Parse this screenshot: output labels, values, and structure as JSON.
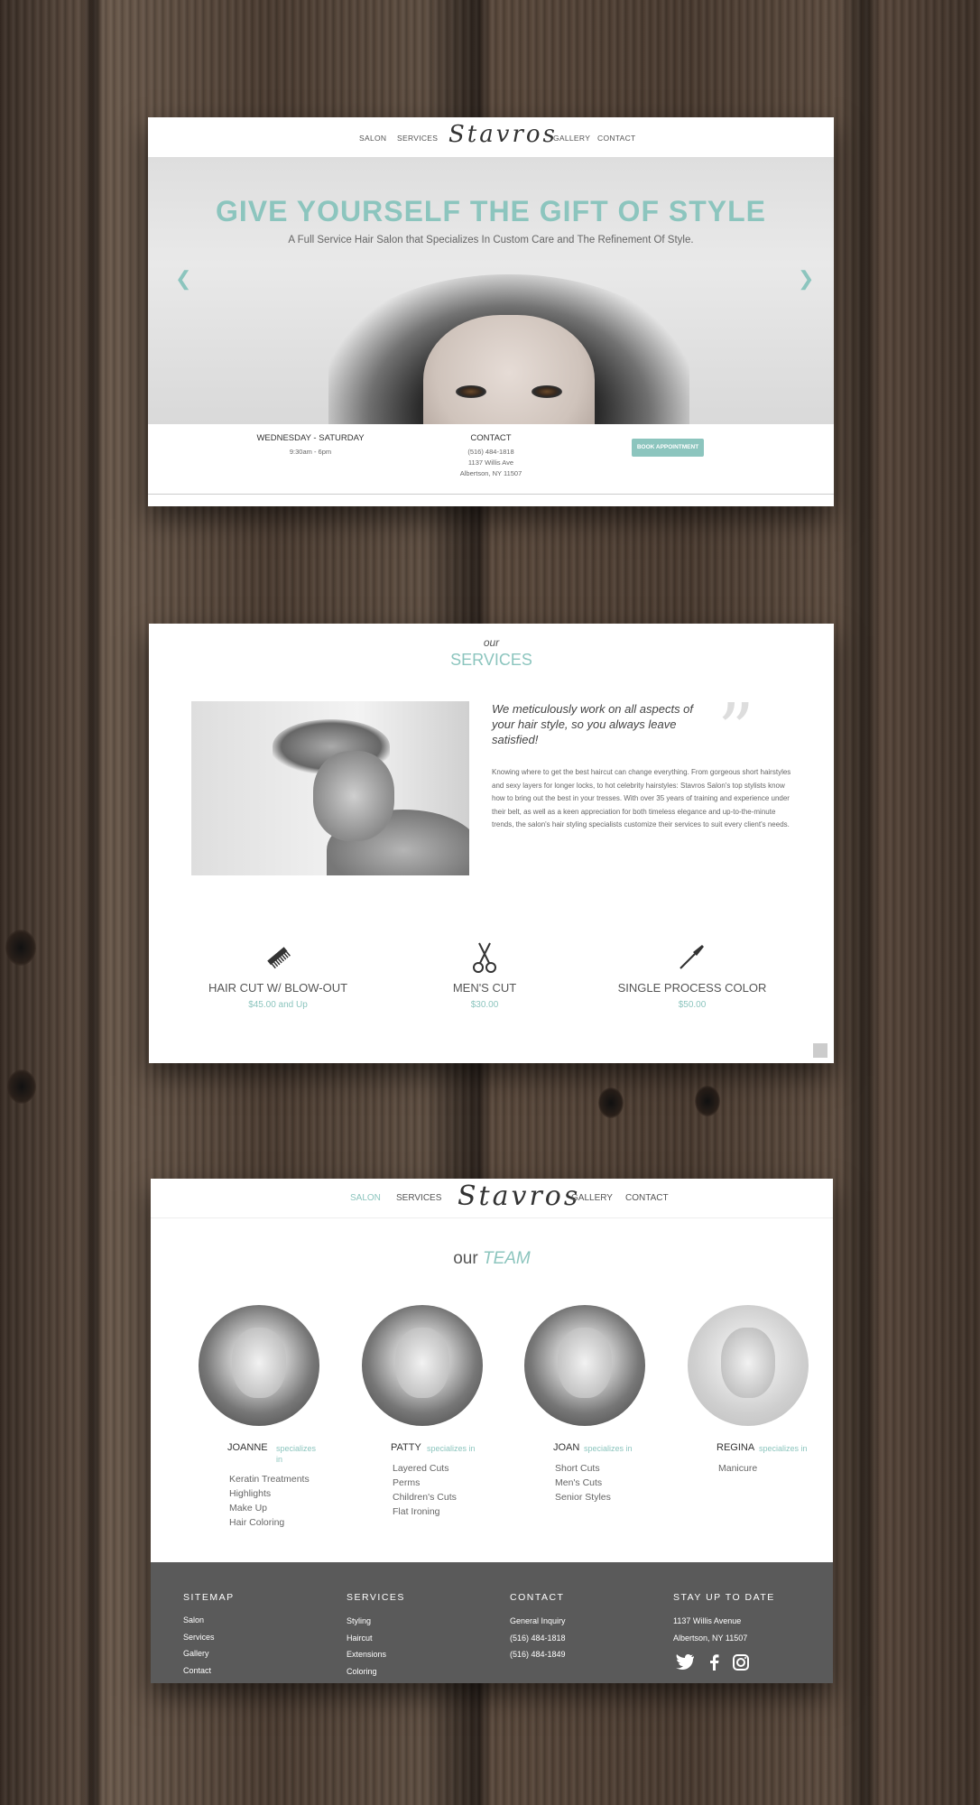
{
  "colors": {
    "accent": "#8cc5be",
    "footer_bg": "#5a5a5a"
  },
  "panel1": {
    "nav": {
      "salon": "SALON",
      "services": "SERVICES",
      "logo": "Stavros",
      "gallery": "GALLERY",
      "contact": "CONTACT"
    },
    "hero": {
      "title": "GIVE YOURSELF THE GIFT OF STYLE",
      "subtitle": "A Full Service Hair Salon that Specializes In Custom Care and The Refinement Of Style.",
      "prev_icon": "chevron-left-icon",
      "next_icon": "chevron-right-icon"
    },
    "hours": {
      "heading": "WEDNESDAY - SATURDAY",
      "time": "9:30am - 6pm"
    },
    "contact": {
      "heading": "CONTACT",
      "phone": "(516) 484-1818",
      "street": "1137 Willis Ave",
      "city": "Albertson, NY 11507"
    },
    "book_button": "BOOK APPOINTMENT"
  },
  "panel2": {
    "our": "our",
    "title": "SERVICES",
    "quote": "We meticulously work on all aspects of your hair style, so you always leave satisfied!",
    "paragraph": "Knowing where to get the best haircut can change everything. From gorgeous short hairstyles and sexy layers for longer locks, to hot celebrity hairstyles: Stavros Salon's top stylists know how to bring out the best in your tresses. With over 35 years of training and experience under their belt, as well as a keen appreciation for both timeless elegance and up-to-the-minute trends, the salon's hair styling specialists customize their services to suit every client's needs.",
    "services": [
      {
        "name": "HAIR CUT W/ BLOW-OUT",
        "price": "$45.00 and Up",
        "icon": "comb-icon"
      },
      {
        "name": "MEN'S CUT",
        "price": "$30.00",
        "icon": "scissors-icon"
      },
      {
        "name": "SINGLE PROCESS COLOR",
        "price": "$50.00",
        "icon": "brush-icon"
      }
    ]
  },
  "panel3": {
    "nav": {
      "salon": "SALON",
      "services": "SERVICES",
      "logo": "Stavros",
      "gallery": "GALLERY",
      "contact": "CONTACT"
    },
    "team_our": "our",
    "team_title": "TEAM",
    "members": [
      {
        "name": "JOANNE",
        "spec": "specializes in",
        "items": [
          "Keratin Treatments",
          "Highlights",
          "Make Up",
          "Hair Coloring"
        ]
      },
      {
        "name": "PATTY",
        "spec": "specializes in",
        "items": [
          "Layered Cuts",
          "Perms",
          "Children's Cuts",
          "Flat Ironing"
        ]
      },
      {
        "name": "JOAN",
        "spec": "specializes in",
        "items": [
          "Short Cuts",
          "Men's Cuts",
          "Senior Styles"
        ]
      },
      {
        "name": "REGINA",
        "spec": "specializes in",
        "items": [
          "Manicure"
        ]
      }
    ],
    "footer": {
      "sitemap": {
        "heading": "SITEMAP",
        "links": [
          "Salon",
          "Services",
          "Gallery",
          "Contact"
        ]
      },
      "services": {
        "heading": "SERVICES",
        "links": [
          "Styling",
          "Haircut",
          "Extensions",
          "Coloring"
        ]
      },
      "contact": {
        "heading": "CONTACT",
        "links": [
          "General Inquiry",
          "(516) 484-1818",
          "(516) 484-1849"
        ]
      },
      "stay": {
        "heading": "STAY UP TO DATE",
        "lines": [
          "1137 Willis Avenue",
          "Albertson, NY 11507"
        ],
        "social": [
          "twitter-icon",
          "facebook-icon",
          "instagram-icon"
        ]
      }
    }
  }
}
